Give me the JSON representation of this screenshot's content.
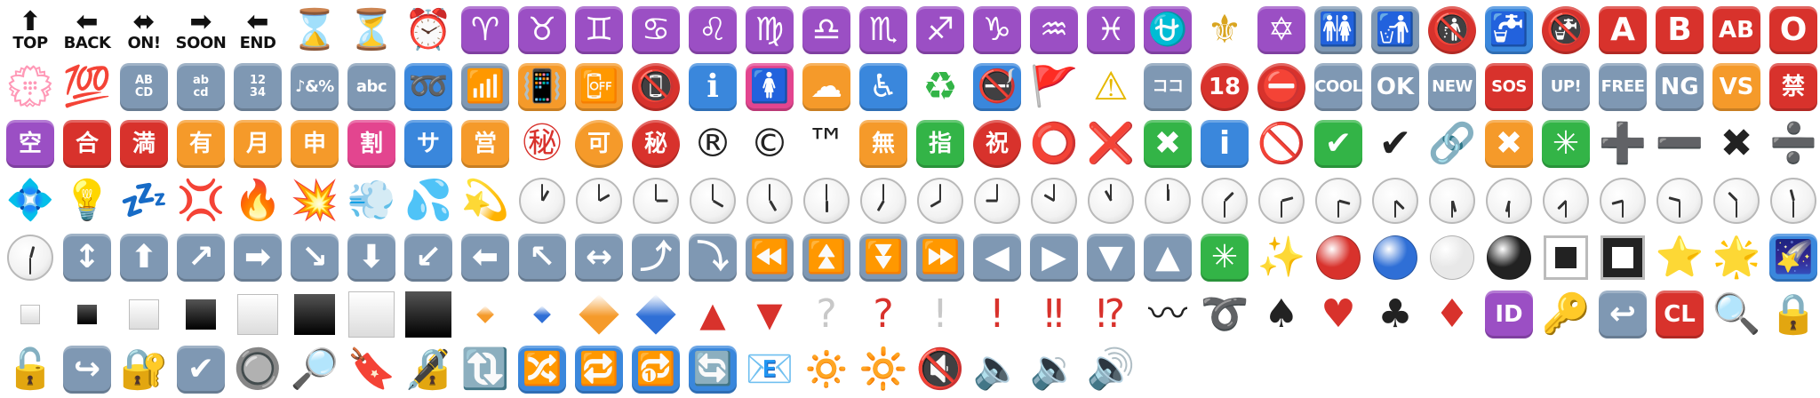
{
  "colors": {
    "purple": "#9b4fc4",
    "blue": "#3a87dc",
    "grey": "#7f98b3",
    "orange": "#f59a2a",
    "red": "#d8322c",
    "green": "#33b447",
    "pink": "#e3458f",
    "black": "#222222"
  },
  "rows": [
    [
      {
        "k": "label",
        "arrow": "⬆",
        "text": "TOP"
      },
      {
        "k": "label",
        "arrow": "⬅",
        "text": "BACK"
      },
      {
        "k": "label",
        "arrow": "⬌",
        "text": "ON!"
      },
      {
        "k": "label",
        "arrow": "➡",
        "text": "SOON"
      },
      {
        "k": "label",
        "arrow": "⬅",
        "text": "END"
      },
      {
        "k": "glyph",
        "g": "⌛",
        "c": "#b8884a"
      },
      {
        "k": "glyph",
        "g": "⏳",
        "c": "#b8884a"
      },
      {
        "k": "glyph",
        "g": "⏰",
        "c": "#c0392b"
      },
      {
        "k": "tile",
        "g": "♈",
        "bg": "purple"
      },
      {
        "k": "tile",
        "g": "♉",
        "bg": "purple"
      },
      {
        "k": "tile",
        "g": "♊",
        "bg": "purple"
      },
      {
        "k": "tile",
        "g": "♋",
        "bg": "purple"
      },
      {
        "k": "tile",
        "g": "♌",
        "bg": "purple"
      },
      {
        "k": "tile",
        "g": "♍",
        "bg": "purple"
      },
      {
        "k": "tile",
        "g": "♎",
        "bg": "purple"
      },
      {
        "k": "tile",
        "g": "♏",
        "bg": "purple"
      },
      {
        "k": "tile",
        "g": "♐",
        "bg": "purple"
      },
      {
        "k": "tile",
        "g": "♑",
        "bg": "purple"
      },
      {
        "k": "tile",
        "g": "♒",
        "bg": "purple"
      },
      {
        "k": "tile",
        "g": "♓",
        "bg": "purple"
      },
      {
        "k": "tile",
        "g": "⛎",
        "bg": "purple"
      },
      {
        "k": "glyph",
        "g": "⚜",
        "c": "#d9a520"
      },
      {
        "k": "tile",
        "g": "✡",
        "bg": "purple"
      },
      {
        "k": "tile",
        "g": "🚻",
        "bg": "grey"
      },
      {
        "k": "tile",
        "g": "🚮",
        "bg": "grey"
      },
      {
        "k": "disc",
        "g": "🚯",
        "bg": "red"
      },
      {
        "k": "tile",
        "g": "🚰",
        "bg": "blue"
      },
      {
        "k": "disc",
        "g": "🚱",
        "bg": "red"
      },
      {
        "k": "tile",
        "g": "A",
        "bg": "red"
      },
      {
        "k": "tile",
        "g": "B",
        "bg": "red"
      },
      {
        "k": "tile",
        "g": "AB",
        "bg": "red",
        "size": "med"
      },
      {
        "k": "tile",
        "g": "O",
        "bg": "red"
      }
    ],
    [
      {
        "k": "glyph",
        "g": "💮",
        "c": "#e05050"
      },
      {
        "k": "glyph",
        "g": "💯",
        "c": "#d8322c"
      },
      {
        "k": "tile",
        "g": "AB\nCD",
        "bg": "grey",
        "size": "xs"
      },
      {
        "k": "tile",
        "g": "ab\ncd",
        "bg": "grey",
        "size": "xs"
      },
      {
        "k": "tile",
        "g": "12\n34",
        "bg": "grey",
        "size": "xs"
      },
      {
        "k": "tile",
        "g": "♪&%",
        "bg": "grey",
        "size": "sm"
      },
      {
        "k": "tile",
        "g": "abc",
        "bg": "grey",
        "size": "sm"
      },
      {
        "k": "tile",
        "g": "➿",
        "bg": "blue"
      },
      {
        "k": "tile",
        "g": "📶",
        "bg": "grey"
      },
      {
        "k": "tile",
        "g": "📳",
        "bg": "orange"
      },
      {
        "k": "tile",
        "g": "📴",
        "bg": "orange"
      },
      {
        "k": "disc",
        "g": "📵",
        "bg": "red"
      },
      {
        "k": "tile",
        "g": "ℹ",
        "bg": "blue"
      },
      {
        "k": "tile",
        "g": "🚺",
        "bg": "pink"
      },
      {
        "k": "tile",
        "g": "☁",
        "bg": "orange"
      },
      {
        "k": "tile",
        "g": "♿",
        "bg": "blue"
      },
      {
        "k": "glyph",
        "g": "♻",
        "c": "#33b447"
      },
      {
        "k": "tile",
        "g": "🚭",
        "bg": "blue"
      },
      {
        "k": "glyph",
        "g": "🚩",
        "c": "#d8322c"
      },
      {
        "k": "glyph",
        "g": "⚠",
        "c": "#e6b800"
      },
      {
        "k": "tile",
        "g": "ココ",
        "bg": "grey",
        "size": "sm"
      },
      {
        "k": "disc",
        "g": "18",
        "bg": "red",
        "size": "med"
      },
      {
        "k": "disc",
        "g": "⛔",
        "bg": "red"
      },
      {
        "k": "tile",
        "g": "COOL",
        "bg": "grey",
        "size": "sm"
      },
      {
        "k": "tile",
        "g": "OK",
        "bg": "grey",
        "size": "med"
      },
      {
        "k": "tile",
        "g": "NEW",
        "bg": "grey",
        "size": "sm"
      },
      {
        "k": "tile",
        "g": "SOS",
        "bg": "red",
        "size": "sm"
      },
      {
        "k": "tile",
        "g": "UP!",
        "bg": "grey",
        "size": "sm"
      },
      {
        "k": "tile",
        "g": "FREE",
        "bg": "grey",
        "size": "sm"
      },
      {
        "k": "tile",
        "g": "NG",
        "bg": "grey",
        "size": "med"
      },
      {
        "k": "tile",
        "g": "VS",
        "bg": "orange",
        "size": "med"
      },
      {
        "k": "tile",
        "g": "禁",
        "bg": "red",
        "size": "med"
      }
    ],
    [
      {
        "k": "tile",
        "g": "空",
        "bg": "purple",
        "size": "med"
      },
      {
        "k": "tile",
        "g": "合",
        "bg": "red",
        "size": "med"
      },
      {
        "k": "tile",
        "g": "満",
        "bg": "red",
        "size": "med"
      },
      {
        "k": "tile",
        "g": "有",
        "bg": "orange",
        "size": "med"
      },
      {
        "k": "tile",
        "g": "月",
        "bg": "orange",
        "size": "med"
      },
      {
        "k": "tile",
        "g": "申",
        "bg": "orange",
        "size": "med"
      },
      {
        "k": "tile",
        "g": "割",
        "bg": "pink",
        "size": "med"
      },
      {
        "k": "tile",
        "g": "サ",
        "bg": "blue",
        "size": "med"
      },
      {
        "k": "tile",
        "g": "営",
        "bg": "orange",
        "size": "med"
      },
      {
        "k": "glyph",
        "g": "㊙",
        "c": "#d8322c"
      },
      {
        "k": "disc",
        "g": "可",
        "bg": "orange",
        "size": "med"
      },
      {
        "k": "disc",
        "g": "秘",
        "bg": "red",
        "size": "med"
      },
      {
        "k": "glyph",
        "g": "®",
        "c": "#222222"
      },
      {
        "k": "glyph",
        "g": "©",
        "c": "#222222"
      },
      {
        "k": "glyph",
        "g": "™",
        "c": "#222222"
      },
      {
        "k": "tile",
        "g": "無",
        "bg": "orange",
        "size": "med"
      },
      {
        "k": "tile",
        "g": "指",
        "bg": "green",
        "size": "med"
      },
      {
        "k": "disc",
        "g": "祝",
        "bg": "red",
        "size": "med"
      },
      {
        "k": "glyph",
        "g": "⭕",
        "c": "#d8322c"
      },
      {
        "k": "glyph",
        "g": "❌",
        "c": "#d8322c"
      },
      {
        "k": "tile",
        "g": "✖",
        "bg": "green"
      },
      {
        "k": "tile",
        "g": "i",
        "bg": "blue"
      },
      {
        "k": "glyph",
        "g": "🚫",
        "c": "#d8322c"
      },
      {
        "k": "tile",
        "g": "✔",
        "bg": "green"
      },
      {
        "k": "glyph",
        "g": "✔",
        "c": "#222222"
      },
      {
        "k": "glyph",
        "g": "🔗",
        "c": "#8a8a8a"
      },
      {
        "k": "tile",
        "g": "✖",
        "bg": "orange"
      },
      {
        "k": "tile",
        "g": "✳",
        "bg": "green"
      },
      {
        "k": "glyph",
        "g": "➕",
        "c": "#222222"
      },
      {
        "k": "glyph",
        "g": "➖",
        "c": "#222222"
      },
      {
        "k": "glyph",
        "g": "✖",
        "c": "#222222"
      },
      {
        "k": "glyph",
        "g": "➗",
        "c": "#222222"
      }
    ],
    [
      {
        "k": "glyph",
        "g": "💠",
        "c": "#3a87dc"
      },
      {
        "k": "glyph",
        "g": "💡",
        "c": "#e0c020"
      },
      {
        "k": "glyph",
        "g": "💤",
        "c": "#2b50a8"
      },
      {
        "k": "glyph",
        "g": "💢",
        "c": "#d8322c"
      },
      {
        "k": "glyph",
        "g": "🔥",
        "c": "#f07020"
      },
      {
        "k": "glyph",
        "g": "💥",
        "c": "#f07020"
      },
      {
        "k": "glyph",
        "g": "💨",
        "c": "#90a8c0"
      },
      {
        "k": "glyph",
        "g": "💦",
        "c": "#3a9ad9"
      },
      {
        "k": "glyph",
        "g": "💫",
        "c": "#e0b000"
      },
      {
        "k": "clock",
        "h": 1,
        "m": 0
      },
      {
        "k": "clock",
        "h": 2,
        "m": 0
      },
      {
        "k": "clock",
        "h": 3,
        "m": 0
      },
      {
        "k": "clock",
        "h": 4,
        "m": 0
      },
      {
        "k": "clock",
        "h": 5,
        "m": 0
      },
      {
        "k": "clock",
        "h": 6,
        "m": 0
      },
      {
        "k": "clock",
        "h": 7,
        "m": 0
      },
      {
        "k": "clock",
        "h": 8,
        "m": 0
      },
      {
        "k": "clock",
        "h": 9,
        "m": 0
      },
      {
        "k": "clock",
        "h": 10,
        "m": 0
      },
      {
        "k": "clock",
        "h": 11,
        "m": 0
      },
      {
        "k": "clock",
        "h": 12,
        "m": 0
      },
      {
        "k": "clock",
        "h": 1,
        "m": 30
      },
      {
        "k": "clock",
        "h": 2,
        "m": 30
      },
      {
        "k": "clock",
        "h": 3,
        "m": 30
      },
      {
        "k": "clock",
        "h": 4,
        "m": 30
      },
      {
        "k": "clock",
        "h": 5,
        "m": 30
      },
      {
        "k": "clock",
        "h": 6,
        "m": 30
      },
      {
        "k": "clock",
        "h": 7,
        "m": 30
      },
      {
        "k": "clock",
        "h": 8,
        "m": 30
      },
      {
        "k": "clock",
        "h": 9,
        "m": 30
      },
      {
        "k": "clock",
        "h": 10,
        "m": 30
      },
      {
        "k": "clock",
        "h": 11,
        "m": 30
      }
    ],
    [
      {
        "k": "clock",
        "h": 12,
        "m": 30
      },
      {
        "k": "tile",
        "g": "↕",
        "bg": "grey"
      },
      {
        "k": "tile",
        "g": "⬆",
        "bg": "grey"
      },
      {
        "k": "tile",
        "g": "↗",
        "bg": "grey"
      },
      {
        "k": "tile",
        "g": "➡",
        "bg": "grey"
      },
      {
        "k": "tile",
        "g": "↘",
        "bg": "grey"
      },
      {
        "k": "tile",
        "g": "⬇",
        "bg": "grey"
      },
      {
        "k": "tile",
        "g": "↙",
        "bg": "grey"
      },
      {
        "k": "tile",
        "g": "⬅",
        "bg": "grey"
      },
      {
        "k": "tile",
        "g": "↖",
        "bg": "grey"
      },
      {
        "k": "tile",
        "g": "↔",
        "bg": "grey"
      },
      {
        "k": "tile",
        "g": "⤴",
        "bg": "grey"
      },
      {
        "k": "tile",
        "g": "⤵",
        "bg": "grey"
      },
      {
        "k": "tile",
        "g": "⏪",
        "bg": "grey"
      },
      {
        "k": "tile",
        "g": "⏫",
        "bg": "grey"
      },
      {
        "k": "tile",
        "g": "⏬",
        "bg": "grey"
      },
      {
        "k": "tile",
        "g": "⏩",
        "bg": "grey"
      },
      {
        "k": "tile",
        "g": "◀",
        "bg": "grey"
      },
      {
        "k": "tile",
        "g": "▶",
        "bg": "grey"
      },
      {
        "k": "tile",
        "g": "▼",
        "bg": "grey"
      },
      {
        "k": "tile",
        "g": "▲",
        "bg": "grey"
      },
      {
        "k": "tile",
        "g": "✳",
        "bg": "green"
      },
      {
        "k": "glyph",
        "g": "✨",
        "c": "#e8c020"
      },
      {
        "k": "shape",
        "shape": "disc",
        "fill": "#d8322c",
        "size": 50
      },
      {
        "k": "shape",
        "shape": "disc",
        "fill": "#2f6fd6",
        "size": 50
      },
      {
        "k": "shape",
        "shape": "disc",
        "fill": "#e8e8e8",
        "size": 50
      },
      {
        "k": "shape",
        "shape": "disc",
        "fill": "#222222",
        "size": 50
      },
      {
        "k": "shape",
        "shape": "framed",
        "fill": "#222222",
        "frame": "#ffffff",
        "size": 50
      },
      {
        "k": "shape",
        "shape": "framed",
        "fill": "#ffffff",
        "frame": "#222222",
        "size": 50
      },
      {
        "k": "glyph",
        "g": "⭐",
        "c": "#f2c21b"
      },
      {
        "k": "glyph",
        "g": "🌟",
        "c": "#f2c21b"
      },
      {
        "k": "tile",
        "g": "🌠",
        "bg": "blue"
      }
    ],
    [
      {
        "k": "shape",
        "shape": "square",
        "fill": "white",
        "size": 22
      },
      {
        "k": "shape",
        "shape": "square",
        "fill": "black",
        "size": 22
      },
      {
        "k": "shape",
        "shape": "square",
        "fill": "white",
        "size": 34
      },
      {
        "k": "shape",
        "shape": "square",
        "fill": "black",
        "size": 34
      },
      {
        "k": "shape",
        "shape": "square",
        "fill": "white",
        "size": 46
      },
      {
        "k": "shape",
        "shape": "square",
        "fill": "black",
        "size": 46
      },
      {
        "k": "shape",
        "shape": "square",
        "fill": "white",
        "size": 52
      },
      {
        "k": "shape",
        "shape": "square",
        "fill": "black",
        "size": 52
      },
      {
        "k": "shape",
        "shape": "diamond",
        "fill": "#f59a2a",
        "size": 14
      },
      {
        "k": "shape",
        "shape": "diamond",
        "fill": "#2f6fd6",
        "size": 14
      },
      {
        "k": "shape",
        "shape": "diamond",
        "fill": "#f59a2a",
        "size": 32
      },
      {
        "k": "shape",
        "shape": "diamond",
        "fill": "#2f6fd6",
        "size": 32
      },
      {
        "k": "glyph",
        "g": "▲",
        "c": "#d8322c",
        "small": true
      },
      {
        "k": "glyph",
        "g": "▼",
        "c": "#d8322c",
        "small": true
      },
      {
        "k": "glyph",
        "g": "?",
        "c": "#c8c8c8"
      },
      {
        "k": "glyph",
        "g": "?",
        "c": "#d8322c"
      },
      {
        "k": "glyph",
        "g": "!",
        "c": "#c8c8c8"
      },
      {
        "k": "glyph",
        "g": "!",
        "c": "#d8322c"
      },
      {
        "k": "glyph",
        "g": "‼",
        "c": "#d8322c"
      },
      {
        "k": "glyph",
        "g": "⁉",
        "c": "#d8322c"
      },
      {
        "k": "glyph",
        "g": "〰",
        "c": "#222222"
      },
      {
        "k": "glyph",
        "g": "➰",
        "c": "#222222"
      },
      {
        "k": "glyph",
        "g": "♠",
        "c": "#222222"
      },
      {
        "k": "glyph",
        "g": "♥",
        "c": "#d8322c"
      },
      {
        "k": "glyph",
        "g": "♣",
        "c": "#222222"
      },
      {
        "k": "glyph",
        "g": "♦",
        "c": "#d8322c"
      },
      {
        "k": "tile",
        "g": "ID",
        "bg": "purple",
        "size": "med"
      },
      {
        "k": "glyph",
        "g": "🔑",
        "c": "#d9a520"
      },
      {
        "k": "tile",
        "g": "↩",
        "bg": "grey"
      },
      {
        "k": "tile",
        "g": "CL",
        "bg": "red",
        "size": "med"
      },
      {
        "k": "glyph",
        "g": "🔍",
        "c": "#555555"
      },
      {
        "k": "glyph",
        "g": "🔒",
        "c": "#d9a520"
      }
    ],
    [
      {
        "k": "glyph",
        "g": "🔓",
        "c": "#d9a520"
      },
      {
        "k": "tile",
        "g": "↪",
        "bg": "grey"
      },
      {
        "k": "glyph",
        "g": "🔐",
        "c": "#d9a520"
      },
      {
        "k": "tile",
        "g": "✔",
        "bg": "grey"
      },
      {
        "k": "glyph",
        "g": "🔘",
        "c": "#777777"
      },
      {
        "k": "glyph",
        "g": "🔎",
        "c": "#555555"
      },
      {
        "k": "glyph",
        "g": "🔖",
        "c": "#d8322c"
      },
      {
        "k": "glyph",
        "g": "🔏",
        "c": "#d9a520"
      },
      {
        "k": "glyph",
        "g": "🔃",
        "c": "#222222"
      },
      {
        "k": "tile",
        "g": "🔀",
        "bg": "blue"
      },
      {
        "k": "tile",
        "g": "🔁",
        "bg": "blue"
      },
      {
        "k": "tile",
        "g": "🔂",
        "bg": "blue"
      },
      {
        "k": "tile",
        "g": "🔄",
        "bg": "blue"
      },
      {
        "k": "glyph",
        "g": "📧",
        "c": "#2f6fd6"
      },
      {
        "k": "glyph",
        "g": "🔅",
        "c": "#f2c21b"
      },
      {
        "k": "glyph",
        "g": "🔆",
        "c": "#f2c21b"
      },
      {
        "k": "glyph",
        "g": "🔇",
        "c": "#777777"
      },
      {
        "k": "glyph",
        "g": "🔈",
        "c": "#777777"
      },
      {
        "k": "glyph",
        "g": "🔉",
        "c": "#777777"
      },
      {
        "k": "glyph",
        "g": "🔊",
        "c": "#777777"
      }
    ]
  ]
}
